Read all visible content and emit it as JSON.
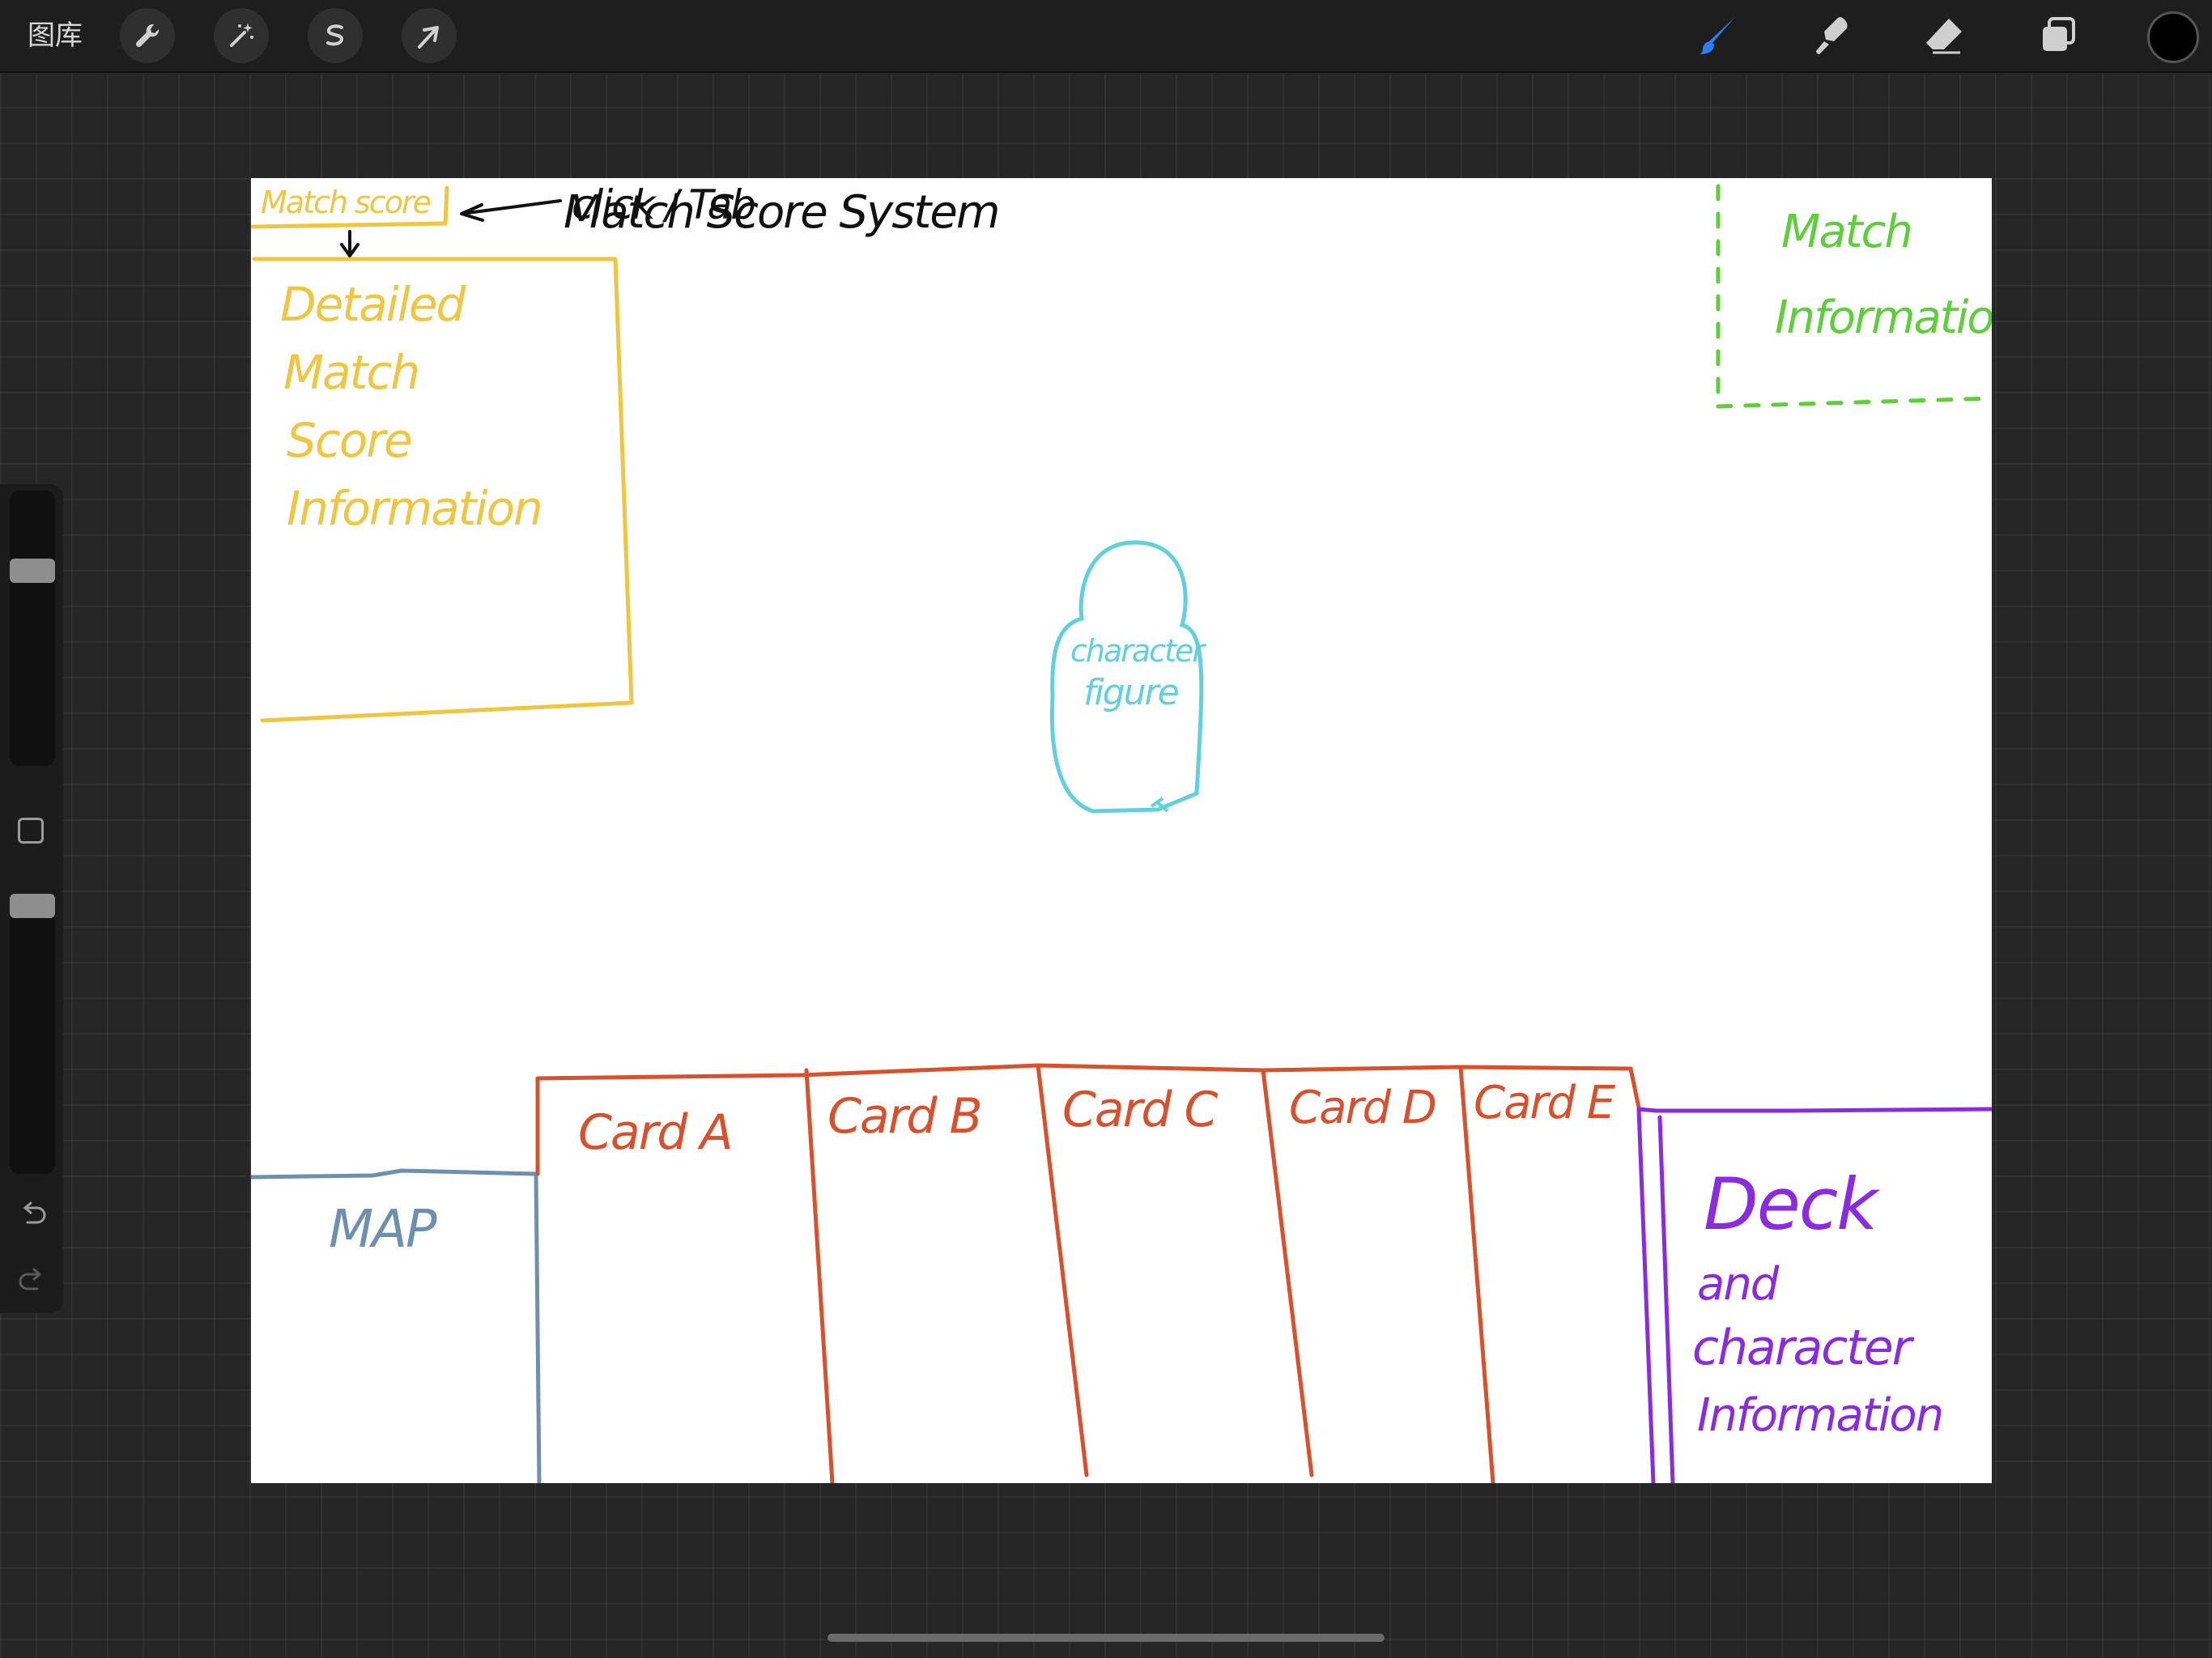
{
  "toolbar": {
    "gallery_label": "图库",
    "left_icons": [
      "wrench-icon",
      "magic-wand-icon",
      "selection-icon",
      "transform-arrow-icon"
    ],
    "right_icons": [
      "brush-icon",
      "smudge-icon",
      "eraser-icon",
      "layers-icon"
    ],
    "active_tool": "brush",
    "active_tool_color": "#2f7cf6",
    "current_color": "#000000"
  },
  "sidebar": {
    "brush_size_level": 0.73,
    "opacity_level": 1.0,
    "icons": [
      "modify-square-icon",
      "undo-icon",
      "redo-icon"
    ]
  },
  "sketch": {
    "title": "Match Score System",
    "score_tab_label": "Match score",
    "click_note": "click / Tab",
    "score_panel_lines": [
      "Detailed",
      "Match",
      "Score",
      "Information"
    ],
    "match_info_lines": [
      "Match",
      "Information"
    ],
    "character_lines": [
      "character",
      "figure"
    ],
    "map_label": "MAP",
    "cards": [
      "Card A",
      "Card B",
      "Card C",
      "Card D",
      "Card E"
    ],
    "deck_lines": [
      "Deck",
      "and",
      "character",
      "Information"
    ],
    "colors": {
      "title": "#111111",
      "score": "#f0c640",
      "match_info": "#5ecf3a",
      "character": "#5fd0dc",
      "map": "#6f8fae",
      "cards": "#d8512c",
      "deck": "#8a2be0"
    }
  }
}
